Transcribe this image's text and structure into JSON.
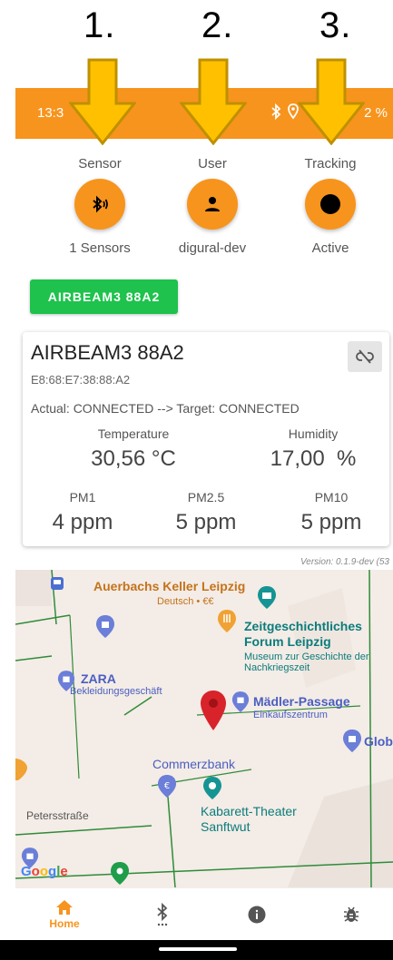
{
  "annotations": [
    "1.",
    "2.",
    "3."
  ],
  "status_bar": {
    "time": "13:3",
    "icons": [
      "bluetooth-icon",
      "location-icon"
    ],
    "battery": "2 %"
  },
  "tiles": [
    {
      "label": "Sensor",
      "value": "1 Sensors",
      "icon": "bluetooth-audio-icon"
    },
    {
      "label": "User",
      "value": "digural-dev",
      "icon": "person-icon"
    },
    {
      "label": "Tracking",
      "value": "Active",
      "icon": "record-dot-icon"
    }
  ],
  "sensor_chip": "AIRBEAM3 88A2",
  "device": {
    "name": "AIRBEAM3 88A2",
    "mac": "E8:68:E7:38:88:A2",
    "state": "Actual: CONNECTED --> Target: CONNECTED",
    "measurements": {
      "temperature": {
        "label": "Temperature",
        "value": "30,56 °C"
      },
      "humidity": {
        "label": "Humidity",
        "value": "17,00  %"
      },
      "pm1": {
        "label": "PM1",
        "value": "4 ppm"
      },
      "pm25": {
        "label": "PM2.5",
        "value": "5 ppm"
      },
      "pm10": {
        "label": "PM10",
        "value": "5 ppm"
      }
    }
  },
  "version": "Version: 0.1.9-dev (53",
  "map": {
    "pois": {
      "auerbachs": {
        "name": "Auerbachs Keller Leipzig",
        "sub": "Deutsch • €€"
      },
      "forum": {
        "name": "Zeitgeschichtliches Forum Leipzig",
        "sub": "Museum zur Geschichte der Nachkriegszeit"
      },
      "zara": {
        "name": "ZARA",
        "sub": "Bekleidungsgeschäft"
      },
      "maedler": {
        "name": "Mädler-Passage",
        "sub": "Einkaufszentrum"
      },
      "commerzbank": {
        "name": "Commerzbank"
      },
      "kabarett": {
        "name": "Kabarett-Theater Sanftwut"
      },
      "glob": {
        "name": "Glob"
      }
    },
    "streets": [
      "Petersstraße"
    ],
    "logo": "Google"
  },
  "bottom_nav": [
    {
      "label": "Home",
      "icon": "home-icon",
      "active": true
    },
    {
      "label": "",
      "icon": "bluetooth-searching-icon"
    },
    {
      "label": "",
      "icon": "info-icon"
    },
    {
      "label": "",
      "icon": "bug-icon"
    }
  ],
  "colors": {
    "accent": "#f7941d",
    "chip_green": "#1ec24c",
    "arrow_yellow": "#ffc000"
  }
}
